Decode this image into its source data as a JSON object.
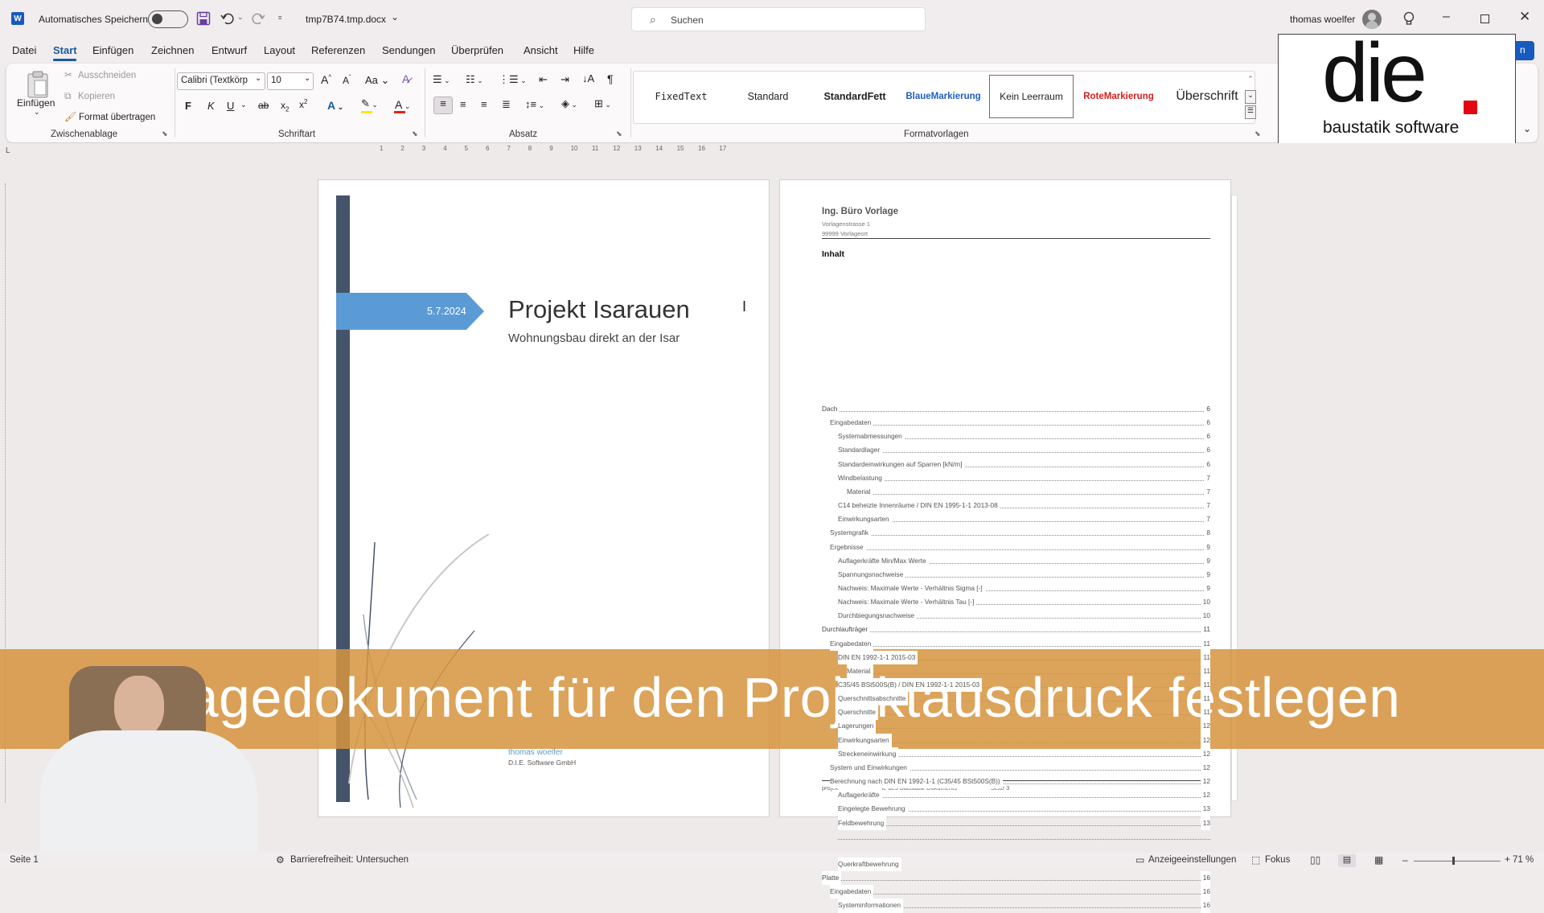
{
  "titlebar": {
    "autosave_label": "Automatisches Speichern",
    "filename": "tmp7B74.tmp.docx",
    "search_placeholder": "Suchen",
    "user": "thomas woelfer"
  },
  "menu": [
    "Datei",
    "Start",
    "Einfügen",
    "Zeichnen",
    "Entwurf",
    "Layout",
    "Referenzen",
    "Sendungen",
    "Überprüfen",
    "Ansicht",
    "Hilfe"
  ],
  "ribbon": {
    "clipboard": {
      "paste": "Einfügen",
      "cut": "Ausschneiden",
      "copy": "Kopieren",
      "format_painter": "Format übertragen",
      "label": "Zwischenablage"
    },
    "font": {
      "name": "Calibri (Textkörp",
      "size": "10",
      "bold": "F",
      "italic": "K",
      "underline": "U",
      "label": "Schriftart"
    },
    "paragraph": {
      "label": "Absatz"
    },
    "styles": {
      "items": [
        "FixedText",
        "Standard",
        "StandardFett",
        "BlaueMarkierung",
        "Kein Leerraum",
        "RoteMarkierung",
        "Überschrift"
      ],
      "label": "Formatvorlagen"
    }
  },
  "logo": {
    "brand": "die",
    "tagline": "baustatik software"
  },
  "ruler": [
    "1",
    "2",
    "3",
    "4",
    "5",
    "6",
    "7",
    "8",
    "9",
    "10",
    "11",
    "12",
    "13",
    "14",
    "15",
    "16",
    "17"
  ],
  "cover": {
    "date": "5.7.2024",
    "title": "Projekt Isarauen",
    "subtitle": "Wohnungsbau direkt an der Isar",
    "author": "thomas woelfer",
    "company": "D.I.E. Software GmbH"
  },
  "toc_page": {
    "company": "Ing. Büro Vorlage",
    "street": "Vorlagenstrasse 1",
    "city": "99999 Vorlageort",
    "heading": "Inhalt",
    "entries": [
      {
        "t": "Dach",
        "p": "6",
        "l": 0
      },
      {
        "t": "Eingabedaten",
        "p": "6",
        "l": 1
      },
      {
        "t": "Systemabmessungen",
        "p": "6",
        "l": 2
      },
      {
        "t": "Standardlager",
        "p": "6",
        "l": 2
      },
      {
        "t": "Standardeinwirkungen auf Sparren [kN/m]",
        "p": "6",
        "l": 2
      },
      {
        "t": "Windbelastung",
        "p": "7",
        "l": 2
      },
      {
        "t": "Material",
        "p": "7",
        "l": 3
      },
      {
        "t": "C14 beheizte Innenräume / DIN EN 1995-1-1 2013-08",
        "p": "7",
        "l": 2
      },
      {
        "t": "Einwirkungsarten",
        "p": "7",
        "l": 2
      },
      {
        "t": "Systemgrafik",
        "p": "8",
        "l": 1
      },
      {
        "t": "Ergebnisse",
        "p": "9",
        "l": 1
      },
      {
        "t": "Auflagerkräfte Min/Max Werte",
        "p": "9",
        "l": 2
      },
      {
        "t": "Spannungsnachweise",
        "p": "9",
        "l": 2
      },
      {
        "t": "Nachweis: Maximale Werte - Verhältnis Sigma [-]",
        "p": "9",
        "l": 2
      },
      {
        "t": "Nachweis: Maximale Werte - Verhältnis Tau [-]",
        "p": "10",
        "l": 2
      },
      {
        "t": "Durchbiegungsnachweise",
        "p": "10",
        "l": 2
      },
      {
        "t": "Durchlaufträger",
        "p": "11",
        "l": 0
      },
      {
        "t": "Eingabedaten",
        "p": "11",
        "l": 1
      },
      {
        "t": "DIN EN 1992-1-1 2015-03",
        "p": "11",
        "l": 2
      },
      {
        "t": "Material",
        "p": "11",
        "l": 3
      },
      {
        "t": "C35/45 BSt500S(B) / DIN EN 1992-1-1 2015-03",
        "p": "11",
        "l": 2
      },
      {
        "t": "Querschnittsabschnitte",
        "p": "11",
        "l": 2
      },
      {
        "t": "Querschnitte",
        "p": "11",
        "l": 2
      },
      {
        "t": "Lagerungen",
        "p": "12",
        "l": 2
      },
      {
        "t": "Einwirkungsarten",
        "p": "12",
        "l": 2
      },
      {
        "t": "Streckeneinwirkung",
        "p": "12",
        "l": 2
      },
      {
        "t": "System und Einwirkungen",
        "p": "12",
        "l": 1
      },
      {
        "t": "Berechnung nach DIN EN 1992-1-1 (C35/45 BSt500S(B))",
        "p": "12",
        "l": 1
      },
      {
        "t": "Auflagerkräfte",
        "p": "12",
        "l": 2
      },
      {
        "t": "Eingelegte Bewehrung",
        "p": "13",
        "l": 2
      },
      {
        "t": "Feldbewehrung",
        "p": "13",
        "l": 2
      },
      {
        "t": "",
        "p": "",
        "l": 2
      },
      {
        "t": "",
        "p": "",
        "l": 2
      },
      {
        "t": "Querkraftbewehrung",
        "p": "",
        "l": 2
      },
      {
        "t": "Platte",
        "p": "16",
        "l": 0
      },
      {
        "t": "Eingabedaten",
        "p": "16",
        "l": 1
      },
      {
        "t": "Systeminformationen",
        "p": "16",
        "l": 2
      }
    ],
    "footer_left": "projekt-isarauen - Name des Baustatik-Dokuments",
    "footer_right": "Seite 3"
  },
  "caption": "Vorlagedokument für den Projektausdruck festlegen",
  "status": {
    "page": "Seite 1",
    "accessibility": "Barrierefreiheit: Untersuchen",
    "display": "Anzeigeeinstellungen",
    "focus": "Fokus",
    "zoom": "71 %"
  },
  "colors": {
    "word_blue": "#185abd",
    "accent": "#5b9bd5",
    "sidebar": "#44546a",
    "caption": "#d6943f",
    "logo_red": "#e30613"
  }
}
